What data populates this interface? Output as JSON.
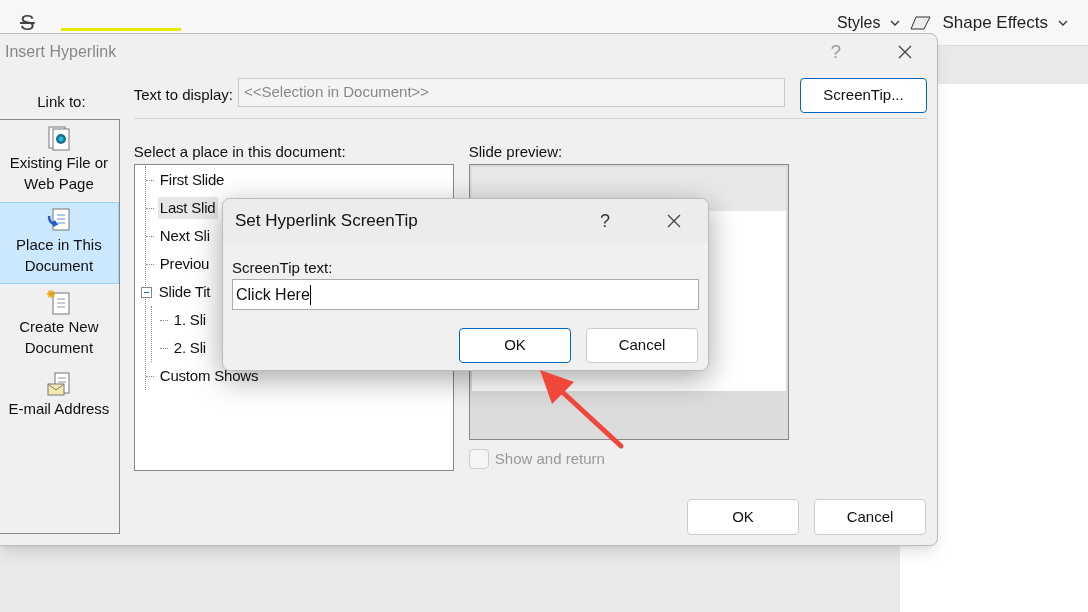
{
  "ribbon": {
    "strikethrough": "S",
    "labels": [
      "Styles",
      "Shape Effects"
    ]
  },
  "dialog": {
    "title": "Insert Hyperlink",
    "help": "?",
    "link_to": {
      "label": "Link to:",
      "items": [
        {
          "label": "Existing File or\nWeb Page",
          "kind": "file",
          "selected": false
        },
        {
          "label": "Place in This\nDocument",
          "kind": "place",
          "selected": true
        },
        {
          "label": "Create New\nDocument",
          "kind": "new",
          "selected": false
        },
        {
          "label": "E-mail Address",
          "kind": "email",
          "selected": false
        }
      ]
    },
    "text_to_display": {
      "label": "Text to display:",
      "value": "<<Selection in Document>>"
    },
    "screentip_button": "ScreenTip...",
    "place_label": "Select a place in this document:",
    "tree": [
      {
        "label": "First Slide",
        "selected": false
      },
      {
        "label": "Last Slid",
        "selected": true
      },
      {
        "label": "Next Sli",
        "selected": false
      },
      {
        "label": "Previou",
        "selected": false
      },
      {
        "label": "Slide Tit",
        "selected": false,
        "expanded": true,
        "children": [
          {
            "label": "1. Sli",
            "selected": false
          },
          {
            "label": "2. Sli",
            "selected": false
          }
        ]
      },
      {
        "label": "Custom Shows",
        "selected": false
      }
    ],
    "preview_label": "Slide preview:",
    "show_and_return": {
      "label": "Show and return",
      "checked": false,
      "disabled": true
    },
    "buttons": [
      "OK",
      "Cancel"
    ]
  },
  "screentip_dialog": {
    "title": "Set Hyperlink ScreenTip",
    "help": "?",
    "field_label": "ScreenTip text:",
    "value": "Click Here",
    "buttons": [
      {
        "label": "OK",
        "default": true
      },
      {
        "label": "Cancel",
        "default": false
      }
    ]
  }
}
